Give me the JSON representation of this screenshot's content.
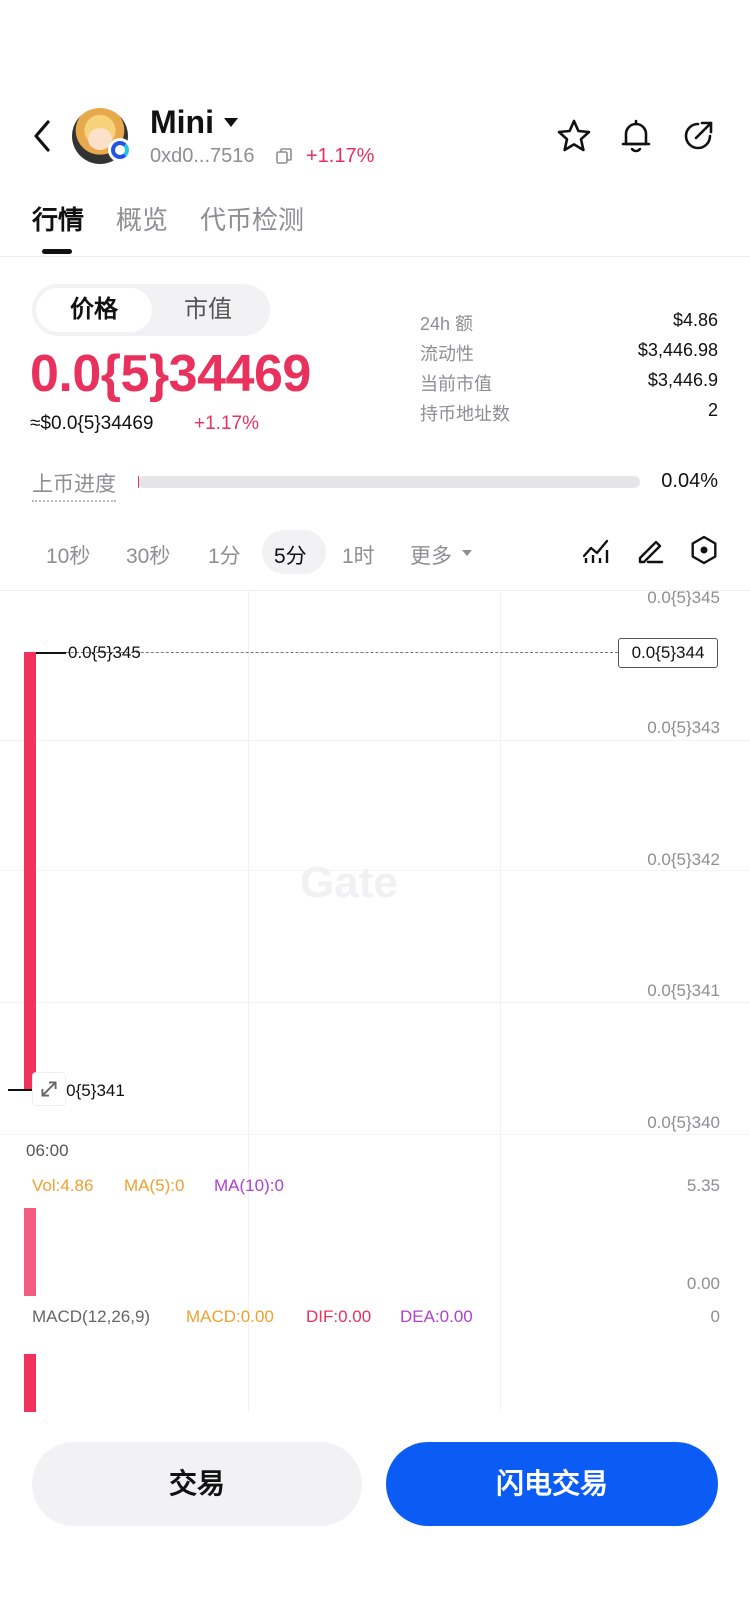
{
  "header": {
    "token_name": "Mini",
    "address": "0xd0...7516",
    "change": "+1.17%",
    "icons": [
      "back-icon",
      "star-icon",
      "bell-icon",
      "share-icon"
    ]
  },
  "tabs": [
    {
      "label": "行情",
      "active": true
    },
    {
      "label": "概览",
      "active": false
    },
    {
      "label": "代币检测",
      "active": false
    }
  ],
  "price_section": {
    "toggle": {
      "price": "价格",
      "market_cap": "市值"
    },
    "price": "0.0{5}34469",
    "usd_price": "≈$0.0{5}34469",
    "usd_change": "+1.17%",
    "stats": [
      {
        "label": "24h  额",
        "value": "$4.86"
      },
      {
        "label": "流动性",
        "value": "$3,446.98"
      },
      {
        "label": "当前市值",
        "value": "$3,446.9"
      },
      {
        "label": "持币地址数",
        "value": "2"
      }
    ],
    "progress": {
      "label": "上币进度",
      "value": "0.04%",
      "fraction": 0.0004
    }
  },
  "intervals": {
    "items": [
      "10秒",
      "30秒",
      "1分",
      "5分",
      "1时"
    ],
    "active": "5分",
    "more": "更多"
  },
  "chart": {
    "watermark": "Gate",
    "axis_labels": [
      "0.0{5}345",
      "0.0{5}343",
      "0.0{5}342",
      "0.0{5}341",
      "0.0{5}340"
    ],
    "current_price_tag": "0.0{5}344",
    "high_label": "0.0{5}345",
    "low_label": "0.0{5}341",
    "time_label": "06:00",
    "volume": {
      "vol": "Vol:4.86",
      "ma5": "MA(5):0",
      "ma10": "MA(10):0",
      "axis_top": "5.35",
      "axis_bottom": "0.00"
    },
    "macd": {
      "label": "MACD(12,26,9)",
      "macd": "MACD:0.00",
      "dif": "DIF:0.00",
      "dea": "DEA:0.00",
      "axis": "0"
    },
    "colors": {
      "down_red": "#f0325d",
      "ma5": "#f0a030",
      "ma10": "#b040d0",
      "dif": "#e8315d"
    }
  },
  "buttons": {
    "trade": "交易",
    "flash_trade": "闪电交易"
  },
  "colors": {
    "accent_red": "#e8315d",
    "primary_blue": "#0a5cf5"
  }
}
